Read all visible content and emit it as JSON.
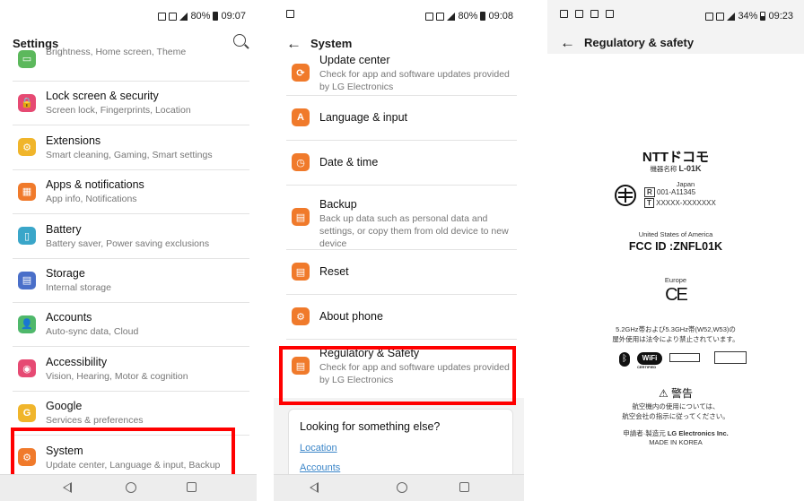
{
  "screen1": {
    "status": {
      "battery": "80%",
      "time": "09:07"
    },
    "title": "Settings",
    "items": [
      {
        "title": "",
        "subtitle": "Brightness, Home screen, Theme",
        "color": "#5cb85c",
        "glyph": "▭"
      },
      {
        "title": "Lock screen & security",
        "subtitle": "Screen lock, Fingerprints, Location",
        "color": "#e64a73",
        "glyph": "🔒"
      },
      {
        "title": "Extensions",
        "subtitle": "Smart cleaning, Gaming, Smart settings",
        "color": "#f0b52b",
        "glyph": "⚙"
      },
      {
        "title": "Apps & notifications",
        "subtitle": "App info, Notifications",
        "color": "#f07a2b",
        "glyph": "▦"
      },
      {
        "title": "Battery",
        "subtitle": "Battery saver, Power saving exclusions",
        "color": "#3aa6c9",
        "glyph": "▯"
      },
      {
        "title": "Storage",
        "subtitle": "Internal storage",
        "color": "#4a6fc9",
        "glyph": "▤"
      },
      {
        "title": "Accounts",
        "subtitle": "Auto-sync data, Cloud",
        "color": "#4fb86b",
        "glyph": "👤"
      },
      {
        "title": "Accessibility",
        "subtitle": "Vision, Hearing, Motor & cognition",
        "color": "#e64a73",
        "glyph": "◉"
      },
      {
        "title": "Google",
        "subtitle": "Services & preferences",
        "color": "#f0b52b",
        "glyph": "G"
      },
      {
        "title": "System",
        "subtitle": "Update center, Language & input, Backup",
        "color": "#f07a2b",
        "glyph": "⚙"
      }
    ]
  },
  "screen2": {
    "status": {
      "battery": "80%",
      "time": "09:08"
    },
    "title": "System",
    "items": [
      {
        "title": "Update center",
        "subtitle": "Check for app and software updates provided by LG Electronics",
        "color": "#f07a2b",
        "glyph": "⟳"
      },
      {
        "title": "Language & input",
        "subtitle": "",
        "color": "#f07a2b",
        "glyph": "A"
      },
      {
        "title": "Date & time",
        "subtitle": "",
        "color": "#f07a2b",
        "glyph": "◷"
      },
      {
        "title": "Backup",
        "subtitle": "Back up data such as personal data and settings, or copy them from old device to new device",
        "color": "#f07a2b",
        "glyph": "▤"
      },
      {
        "title": "Reset",
        "subtitle": "",
        "color": "#f07a2b",
        "glyph": "▤"
      },
      {
        "title": "About phone",
        "subtitle": "",
        "color": "#f07a2b",
        "glyph": "⚙"
      },
      {
        "title": "Regulatory & Safety",
        "subtitle": "Check for app and software updates provided by LG Electronics",
        "color": "#f07a2b",
        "glyph": "▤"
      }
    ],
    "search_card": {
      "heading": "Looking for something else?",
      "links": [
        "Location",
        "Accounts"
      ]
    }
  },
  "screen3": {
    "status": {
      "battery": "34%",
      "time": "09:23"
    },
    "title": "Regulatory & safety",
    "ntt_brand": "NTTドコモ",
    "ntt_model_label": "機器名称",
    "ntt_model": "L-01K",
    "japan_label": "Japan",
    "japan_r_code": "001-A11345",
    "japan_t_code": "XXXXX-XXXXXXX",
    "usa_label": "United States of America",
    "fcc_id": "FCC ID :ZNFL01K",
    "europe_label": "Europe",
    "ce_mark": "CE",
    "wifi_note_1": "5.2GHz帯および5.3GHz帯(W52,W53)の",
    "wifi_note_2": "屋外使用は法令により禁止されています。",
    "wifi_certified": "CERTIFIED",
    "warning_title": "警告",
    "warning_1": "航空機内の使用については、",
    "warning_2": "航空会社の指示に従ってください。",
    "maker_label": "申請者·製造元",
    "maker": "LG Electronics Inc.",
    "made_in": "MADE IN KOREA"
  }
}
